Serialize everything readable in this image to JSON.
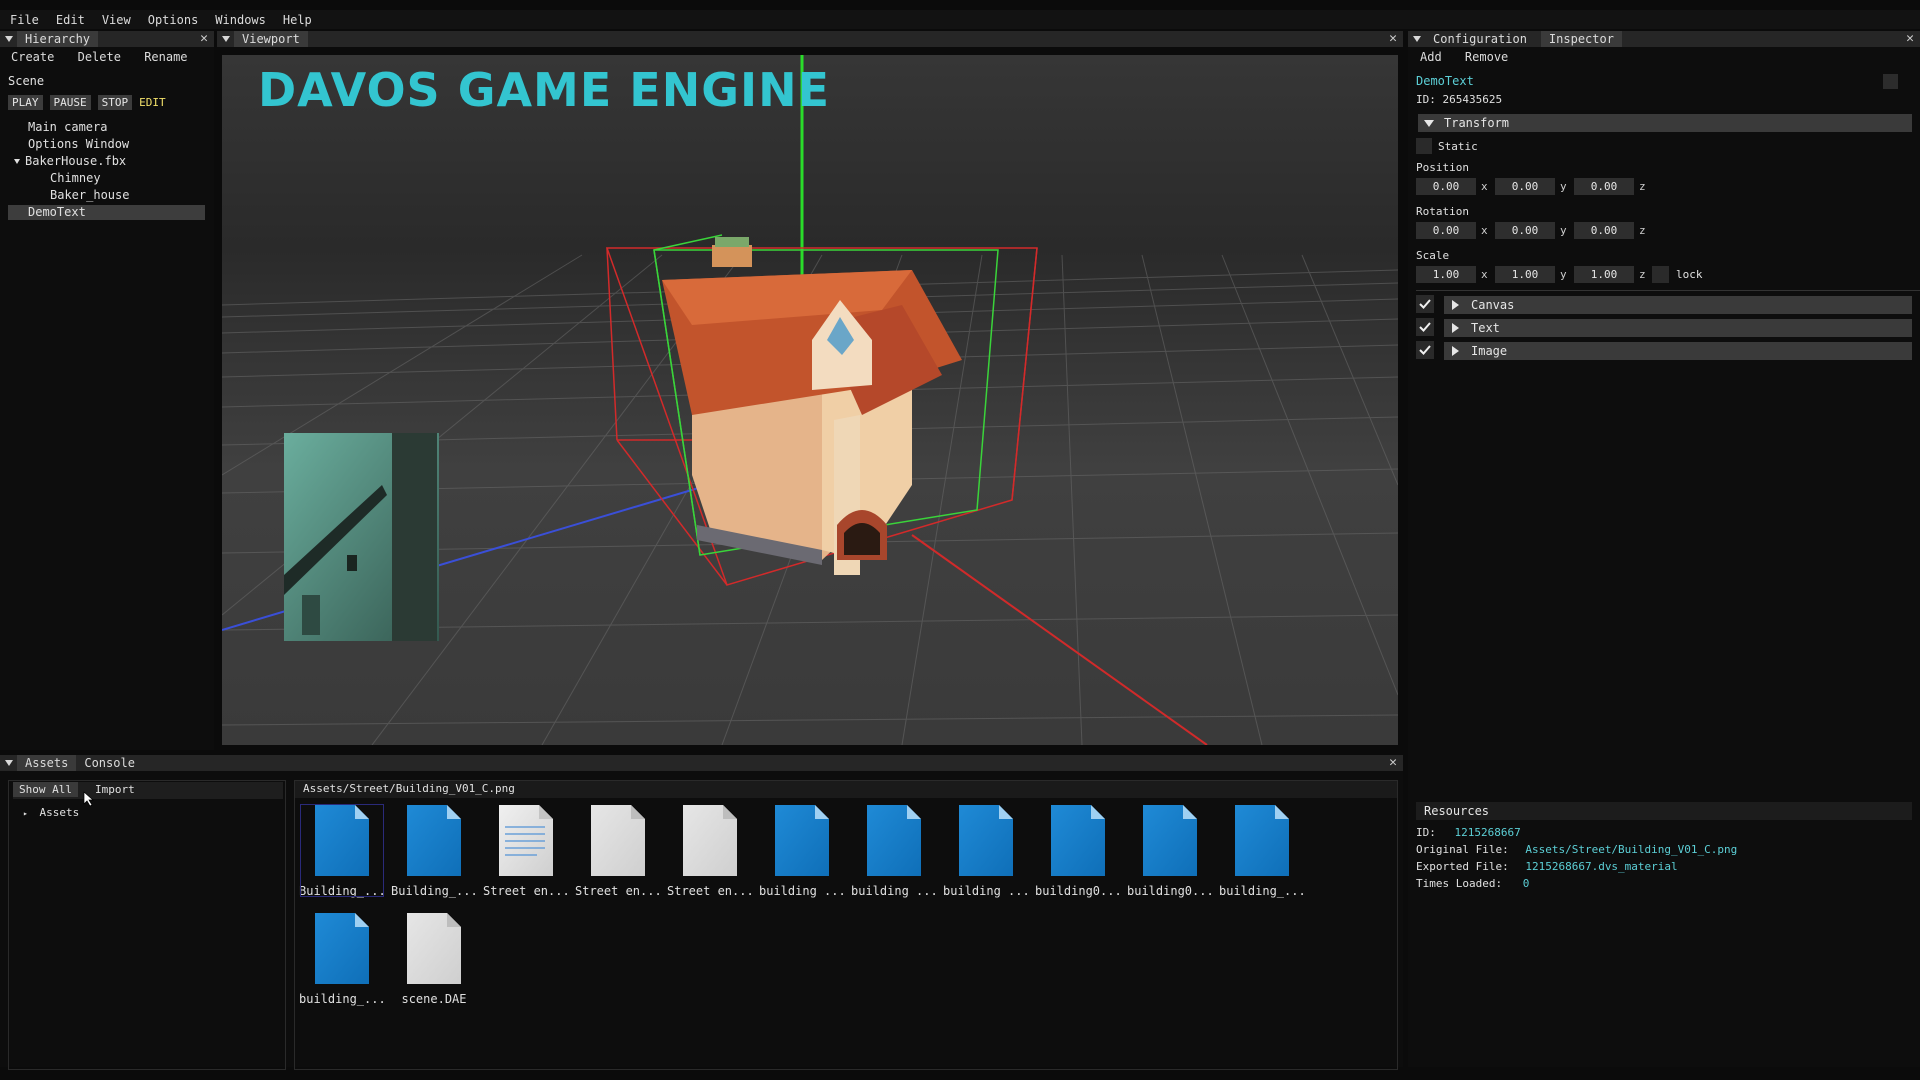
{
  "menu": [
    "File",
    "Edit",
    "View",
    "Options",
    "Windows",
    "Help"
  ],
  "hierarchy": {
    "tab": "Hierarchy",
    "actions": [
      "Create",
      "Delete",
      "Rename"
    ],
    "scene_label": "Scene",
    "controls": [
      "PLAY",
      "PAUSE",
      "STOP"
    ],
    "mode": "EDIT",
    "items": [
      {
        "label": "Main camera",
        "indent": 1,
        "expanded": null,
        "selected": false
      },
      {
        "label": "Options Window",
        "indent": 1,
        "expanded": null,
        "selected": false
      },
      {
        "label": "BakerHouse.fbx",
        "indent": 1,
        "expanded": true,
        "selected": false
      },
      {
        "label": "Chimney",
        "indent": 2,
        "expanded": null,
        "selected": false
      },
      {
        "label": "Baker_house",
        "indent": 2,
        "expanded": null,
        "selected": false
      },
      {
        "label": "DemoText",
        "indent": 0,
        "expanded": null,
        "selected": true
      }
    ]
  },
  "viewport": {
    "tab": "Viewport",
    "overlay_title": "DAVOS GAME ENGINE",
    "title_color": "#33c5d0"
  },
  "inspector": {
    "tabs": [
      "Configuration",
      "Inspector"
    ],
    "active_tab": "Inspector",
    "actions": [
      "Add",
      "Remove"
    ],
    "object_name": "DemoText",
    "id_text": "ID: 265435625",
    "transform": {
      "header": "Transform",
      "static_label": "Static",
      "position_label": "Position",
      "position": [
        "0.00",
        "0.00",
        "0.00"
      ],
      "rotation_label": "Rotation",
      "rotation": [
        "0.00",
        "0.00",
        "0.00"
      ],
      "scale_label": "Scale",
      "scale": [
        "1.00",
        "1.00",
        "1.00"
      ],
      "axes": [
        "x",
        "y",
        "z"
      ],
      "lock_label": "lock"
    },
    "components": [
      {
        "label": "Canvas",
        "enabled": true
      },
      {
        "label": "Text",
        "enabled": true
      },
      {
        "label": "Image",
        "enabled": true
      }
    ],
    "resources": {
      "header": "Resources",
      "id_label": "ID:",
      "id_value": "1215268667",
      "original_label": "Original File:",
      "original_value": "Assets/Street/Building_V01_C.png",
      "exported_label": "Exported File:",
      "exported_value": "1215268667.dvs_material",
      "loaded_label": "Times Loaded:",
      "loaded_value": "0"
    }
  },
  "assets": {
    "tabs": [
      "Assets",
      "Console"
    ],
    "buttons": [
      "Show All",
      "Import"
    ],
    "tree_root": "Assets",
    "path": "Assets/Street/Building_V01_C.png",
    "files": [
      {
        "name": "Building_...",
        "kind": "image"
      },
      {
        "name": "Building_...",
        "kind": "image"
      },
      {
        "name": "Street en...",
        "kind": "text"
      },
      {
        "name": "Street en...",
        "kind": "blank"
      },
      {
        "name": "Street en...",
        "kind": "blank"
      },
      {
        "name": "building ...",
        "kind": "image"
      },
      {
        "name": "building ...",
        "kind": "image"
      },
      {
        "name": "building ...",
        "kind": "image"
      },
      {
        "name": "building0...",
        "kind": "image"
      },
      {
        "name": "building0...",
        "kind": "image"
      },
      {
        "name": "building_...",
        "kind": "image"
      },
      {
        "name": "building_...",
        "kind": "image"
      },
      {
        "name": "scene.DAE",
        "kind": "blank"
      }
    ]
  }
}
